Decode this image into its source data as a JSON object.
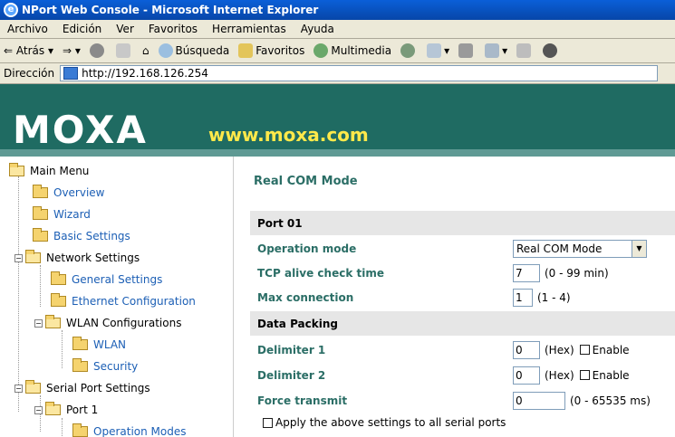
{
  "window": {
    "title": "NPort Web Console - Microsoft Internet Explorer"
  },
  "menu": [
    "Archivo",
    "Edición",
    "Ver",
    "Favoritos",
    "Herramientas",
    "Ayuda"
  ],
  "toolbar": {
    "back": "Atrás",
    "search": "Búsqueda",
    "favorites": "Favoritos",
    "media": "Multimedia"
  },
  "address": {
    "label": "Dirección",
    "url": "http://192.168.126.254"
  },
  "banner": {
    "logo": "MOXA",
    "site": "www.moxa.com"
  },
  "sidebar": {
    "main": "Main Menu",
    "overview": "Overview",
    "wizard": "Wizard",
    "basic": "Basic Settings",
    "network": "Network Settings",
    "general": "General Settings",
    "ethernet": "Ethernet Configuration",
    "wlan_conf": "WLAN Configurations",
    "wlan": "WLAN",
    "security": "Security",
    "serial": "Serial Port Settings",
    "port1": "Port 1",
    "opmodes": "Operation Modes"
  },
  "content": {
    "title": "Real COM Mode",
    "port": "Port 01",
    "op_label": "Operation mode",
    "op_value": "Real COM Mode",
    "tcp_label": "TCP alive check time",
    "tcp_value": "7",
    "tcp_hint": "(0 - 99 min)",
    "max_label": "Max connection",
    "max_value": "1",
    "max_hint": "(1 - 4)",
    "packing": "Data Packing",
    "d1_label": "Delimiter 1",
    "d1_value": "0",
    "d2_label": "Delimiter 2",
    "d2_value": "0",
    "hex": "(Hex)",
    "enable": "Enable",
    "force_label": "Force transmit",
    "force_value": "0",
    "force_hint": "(0 - 65535 ms)",
    "apply": "Apply the above settings to all serial ports"
  }
}
